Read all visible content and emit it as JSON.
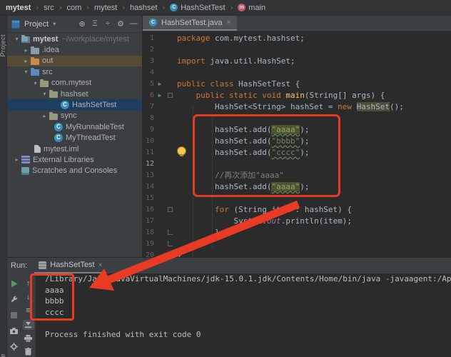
{
  "breadcrumb": {
    "items": [
      {
        "label": "mytest",
        "bold": true
      },
      {
        "label": "src"
      },
      {
        "label": "com"
      },
      {
        "label": "mytest"
      },
      {
        "label": "hashset"
      },
      {
        "label": "HashSetTest",
        "icon": "class-icon",
        "icon_letter": "C"
      },
      {
        "label": "main",
        "icon": "method-icon",
        "icon_letter": "m"
      }
    ]
  },
  "left_strip": {
    "top_label": "Project",
    "bottom_label": "re"
  },
  "project_panel": {
    "title": "Project",
    "caret": "▾",
    "toolbar": [
      {
        "name": "locate-button",
        "glyph": "⊕"
      },
      {
        "name": "expand-all-button",
        "glyph": "Ξ"
      },
      {
        "name": "collapse-all-button",
        "glyph": "÷"
      },
      {
        "name": "settings-gear-button",
        "glyph": "⚙"
      },
      {
        "name": "hide-panel-button",
        "glyph": "—"
      }
    ],
    "tree": [
      {
        "indent": 7,
        "chevron": "down",
        "icon": "project-folder",
        "label": "mytest",
        "bold": true,
        "sublabel": "~/workplace/mytest"
      },
      {
        "indent": 20,
        "chevron": "right",
        "icon": "folder",
        "label": ".idea"
      },
      {
        "indent": 20,
        "chevron": "right",
        "icon": "folder-excluded",
        "label": "out",
        "state": "excluded"
      },
      {
        "indent": 20,
        "chevron": "down",
        "icon": "folder-src",
        "label": "src"
      },
      {
        "indent": 33,
        "chevron": "down",
        "icon": "package",
        "label": "com.mytest"
      },
      {
        "indent": 46,
        "chevron": "down",
        "icon": "package",
        "label": "hashset"
      },
      {
        "indent": 62,
        "chevron": "none",
        "icon": "class",
        "icon_letter": "C",
        "label": "HashSetTest",
        "state": "selected"
      },
      {
        "indent": 46,
        "chevron": "right",
        "icon": "package",
        "label": "sync"
      },
      {
        "indent": 53,
        "chevron": "none",
        "icon": "class",
        "icon_letter": "C",
        "label": "MyRunnableTest"
      },
      {
        "indent": 53,
        "chevron": "none",
        "icon": "class",
        "icon_letter": "C",
        "label": "MyThreadTest"
      },
      {
        "indent": 25,
        "chevron": "none",
        "icon": "file",
        "label": "mytest.iml"
      },
      {
        "indent": 7,
        "chevron": "right",
        "icon": "libraries",
        "label": "External Libraries"
      },
      {
        "indent": 7,
        "chevron": "none",
        "icon": "scratches",
        "label": "Scratches and Consoles"
      }
    ]
  },
  "editor": {
    "tab_label": "HashSetTest.java",
    "tab_close": "×",
    "tab_icon_letter": "C",
    "lines": [
      {
        "n": 1,
        "segs": [
          {
            "t": "package ",
            "c": "kw"
          },
          {
            "t": "com.mytest.hashset;",
            "c": "id"
          }
        ]
      },
      {
        "n": 2,
        "segs": []
      },
      {
        "n": 3,
        "segs": [
          {
            "t": "import ",
            "c": "kw"
          },
          {
            "t": "java.util.HashSet;",
            "c": "id"
          }
        ]
      },
      {
        "n": 4,
        "segs": []
      },
      {
        "n": 5,
        "marker": "run",
        "segs": [
          {
            "t": "public class ",
            "c": "kw"
          },
          {
            "t": "HashSetTest {",
            "c": "id"
          }
        ]
      },
      {
        "n": 6,
        "marker": "run",
        "fold": "box",
        "segs": [
          {
            "t": "    ",
            "c": "id"
          },
          {
            "t": "public static void ",
            "c": "kw"
          },
          {
            "t": "main",
            "c": "fn"
          },
          {
            "t": "(String[] args) {",
            "c": "id"
          }
        ]
      },
      {
        "n": 7,
        "segs": [
          {
            "t": "        HashSet<String> hashSet = ",
            "c": "id"
          },
          {
            "t": "new ",
            "c": "kw"
          },
          {
            "t": "HashSet",
            "c": "hl"
          },
          {
            "t": "();",
            "c": "id"
          }
        ]
      },
      {
        "n": 8,
        "segs": []
      },
      {
        "n": 9,
        "segs": [
          {
            "t": "        hashSet.add(",
            "c": "id"
          },
          {
            "t": "\"aaaa\"",
            "c": "strhl"
          },
          {
            "t": ");",
            "c": "id"
          }
        ]
      },
      {
        "n": 10,
        "segs": [
          {
            "t": "        hashSet.add(",
            "c": "id"
          },
          {
            "t": "\"bbbb\"",
            "c": "strun"
          },
          {
            "t": ");",
            "c": "id"
          }
        ]
      },
      {
        "n": 11,
        "segs": [
          {
            "t": "        hashSet.add(",
            "c": "id"
          },
          {
            "t": "\"cccc\"",
            "c": "strun"
          },
          {
            "t": ");",
            "c": "id"
          }
        ]
      },
      {
        "n": 12,
        "current": true,
        "segs": []
      },
      {
        "n": 13,
        "segs": [
          {
            "t": "        ",
            "c": "id"
          },
          {
            "t": "//再次添加\"aaaa\"",
            "c": "cmt"
          }
        ]
      },
      {
        "n": 14,
        "segs": [
          {
            "t": "        hashSet.add(",
            "c": "id"
          },
          {
            "t": "\"aaaa\"",
            "c": "strhl"
          },
          {
            "t": ");",
            "c": "id"
          }
        ]
      },
      {
        "n": 15,
        "segs": []
      },
      {
        "n": 16,
        "fold": "box",
        "segs": [
          {
            "t": "        ",
            "c": "id"
          },
          {
            "t": "for",
            "c": "kw"
          },
          {
            "t": " (String item : hashSet) {",
            "c": "id"
          }
        ]
      },
      {
        "n": 17,
        "segs": [
          {
            "t": "            System.",
            "c": "id"
          },
          {
            "t": "out",
            "c": "field"
          },
          {
            "t": ".println(item);",
            "c": "id"
          }
        ]
      },
      {
        "n": 18,
        "fold": "end",
        "segs": [
          {
            "t": "        }",
            "c": "id"
          }
        ]
      },
      {
        "n": 19,
        "fold": "end",
        "segs": [
          {
            "t": "    }",
            "c": "id"
          }
        ]
      },
      {
        "n": 20,
        "segs": [
          {
            "t": "}",
            "c": "id"
          }
        ]
      }
    ]
  },
  "run": {
    "label": "Run:",
    "tab_label": "HashSetTest",
    "tab_close": "×",
    "toolbar_left": [
      {
        "name": "rerun-button",
        "icon": "play"
      },
      {
        "name": "build-settings-button",
        "icon": "wrench"
      },
      {
        "name": "stop-button",
        "icon": "stop"
      },
      {
        "name": "screenshot-button",
        "icon": "camera"
      },
      {
        "name": "settings-gear-button",
        "icon": "gear"
      }
    ],
    "toolbar_console": [
      {
        "name": "up-stacktrace-button",
        "icon": "arrow-up"
      },
      {
        "name": "down-stacktrace-button",
        "icon": "arrow-down"
      },
      {
        "name": "soft-wrap-button",
        "icon": "lines"
      },
      {
        "name": "scroll-to-end-button",
        "icon": "scroll-end",
        "selected": true
      },
      {
        "name": "print-button",
        "icon": "printer"
      },
      {
        "name": "clear-console-button",
        "icon": "trash"
      }
    ],
    "console_lines": [
      "/Library/Java/JavaVirtualMachines/jdk-15.0.1.jdk/Contents/Home/bin/java -javaagent:/Applicati",
      "aaaa",
      "bbbb",
      "cccc",
      "",
      "Process finished with exit code 0"
    ]
  },
  "colors": {
    "annotation_red": "#E93A23",
    "editor_bg": "#2B2B2B",
    "panel_bg": "#3C3F41",
    "keyword_orange": "#CC7832",
    "string_green": "#6A8759",
    "method_yellow": "#FFC66D",
    "field_purple": "#9876AA",
    "comment_gray": "#808080",
    "selection_blue": "#1D3E5F",
    "excluded_brown": "#564C36",
    "run_green": "#4F9E58",
    "bulb_yellow": "#F4C64D",
    "class_icon_teal": "#38A7B2",
    "method_icon_pink": "#C4596F"
  }
}
